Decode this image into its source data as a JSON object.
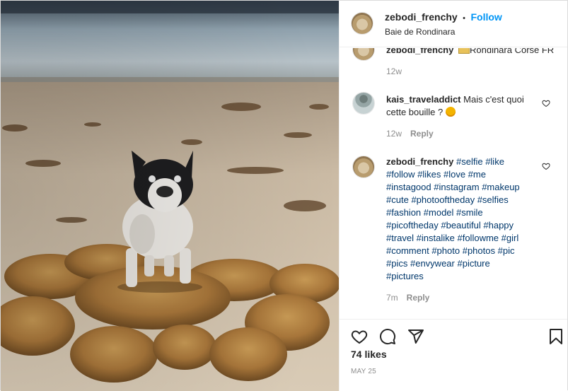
{
  "post": {
    "username": "zebodi_frenchy",
    "separator": "•",
    "follow_label": "Follow",
    "location": "Baie de Rondinara"
  },
  "comments": [
    {
      "username": "zebodi_frenchy",
      "text": "Rondinara Corse FR",
      "time": "12w"
    },
    {
      "username": "kais_traveladdict",
      "text_line1": "Mais c'est quoi",
      "text_line2": "cette bouille ?",
      "time": "12w",
      "reply_label": "Reply"
    },
    {
      "username": "zebodi_frenchy",
      "hashtags_line1": [
        "#selfie",
        "#like"
      ],
      "hashtags_lines": [
        [
          "#follow",
          "#likes",
          "#love",
          "#me"
        ],
        [
          "#instagood",
          "#instagram",
          "#makeup"
        ],
        [
          "#cute",
          "#photooftheday",
          "#selfies"
        ],
        [
          "#fashion",
          "#model",
          "#smile"
        ],
        [
          "#picoftheday",
          "#beautiful",
          "#happy"
        ],
        [
          "#travel",
          "#instalike",
          "#followme",
          "#girl"
        ],
        [
          "#comment",
          "#photo",
          "#photos",
          "#pic"
        ],
        [
          "#pics",
          "#envywear",
          "#picture"
        ],
        [
          "#pictures"
        ]
      ],
      "time": "7m",
      "reply_label": "Reply"
    }
  ],
  "likes": "74 likes",
  "date": "MAY 25",
  "colors": {
    "accent": "#0095f6",
    "hashtag": "#00376b",
    "muted": "#8e8e8e"
  }
}
